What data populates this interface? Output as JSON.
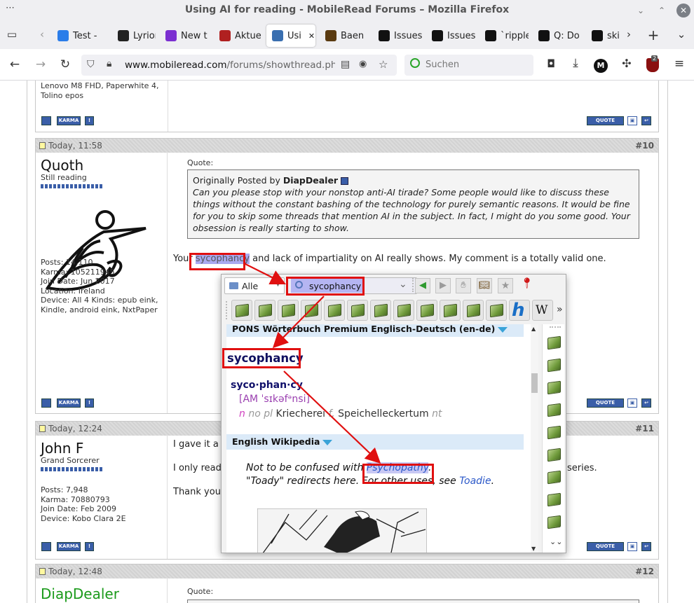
{
  "window": {
    "title": "Using AI for reading - MobileRead Forums – Mozilla Firefox",
    "menu_dots": "⋯"
  },
  "tabs": [
    {
      "label": "Test -",
      "color": "#2b7de9"
    },
    {
      "label": "Lyrion",
      "color": "#222222"
    },
    {
      "label": "New t",
      "color": "#7b2fd1"
    },
    {
      "label": "Aktue",
      "color": "#b02020"
    },
    {
      "label": "Usi",
      "color": "#3a6fb0",
      "active": true
    },
    {
      "label": "Baen",
      "color": "#5a3a10"
    },
    {
      "label": "Issues",
      "color": "#111111"
    },
    {
      "label": "Issues",
      "color": "#111111"
    },
    {
      "label": "`ripple",
      "color": "#111111"
    },
    {
      "label": "Q: Do",
      "color": "#111111"
    },
    {
      "label": "ski",
      "color": "#111111"
    }
  ],
  "nav": {
    "url": "www.mobileread.com/forums/showthread.php?p=",
    "url_domain": "www.mobileread.com",
    "url_path": "/forums/showthread.php?p=",
    "search_placeholder": "Suchen",
    "ext_badge": "2"
  },
  "posts": [
    {
      "device_tail": "Lenovo M8 FHD, Paperwhite 4, Tolino epos"
    },
    {
      "time": "Today, 11:58",
      "number": "#10",
      "username": "Quoth",
      "usertitle": "Still reading",
      "stats": [
        "Posts: 14,110",
        "Karma: 105211945",
        "Join Date: Jun 2017",
        "Location: Ireland",
        "Device: All 4 Kinds: epub eink, Kindle, android eink, NxtPaper"
      ],
      "quote_label": "Quote:",
      "quote_prefix": "Originally Posted by",
      "quote_author": "DiapDealer",
      "quote_text": "Can you please stop with your nonstop anti-AI tirade? Some people would like to discuss these things without the constant bashing of the technology for purely semantic reasons. It would be fine for you to skip some threads that mention AI in the subject. In fact, I might do you some good. Your obsession is really starting to show.",
      "reply_before": "Your",
      "reply_highlight": "sycophancy",
      "reply_after": "and lack of impartiality on AI really shows. My comment is a totally valid one."
    },
    {
      "time": "Today, 12:24",
      "number": "#11",
      "username": "John F",
      "usertitle": "Grand Sorcerer",
      "stats": [
        "Posts: 7,948",
        "Karma: 70880793",
        "Join Date: Feb 2009",
        "Device: Kobo Clara 2E"
      ],
      "lines": [
        "I gave it a tr",
        "I only read c",
        "Thank you B"
      ],
      "line_tail": "series."
    },
    {
      "time": "Today, 12:48",
      "number": "#12",
      "username": "DiapDealer",
      "quote_label": "Quote:"
    }
  ],
  "buttons": {
    "karma": "KARMA",
    "quote": "QUOTE",
    "report": "!"
  },
  "popup": {
    "dict_filter": "Alle",
    "search_value": "sycophancy",
    "dictionary1": "PONS Wörterbuch Premium Englisch-Deutsch (en-de)",
    "headword": "sycophancy",
    "syllabified": "syco·phan·cy",
    "pron_region": "AM",
    "pronunciation": "ˈsɪkəfᵊnsi",
    "pos": "n",
    "grammar": "no pl",
    "translation1": "Kriecherei",
    "separator": "f,",
    "translation2": "Speichelleckertum",
    "gender2": "nt",
    "dictionary2": "English Wikipedia",
    "wiki_line1_prefix": "Not to be confused with",
    "wiki_link1": "Psychopathy",
    "wiki_line1_suffix": ".",
    "wiki_line2_prefix": "\"Toady\" redirects here. For other uses, see",
    "wiki_link2": "Toadie",
    "wiki_line2_suffix": ".",
    "more_chevron": "»",
    "scroll_down": "⌄⌄",
    "h_icon": "h",
    "w_icon": "W"
  },
  "colors": {
    "accent_red": "#e01010",
    "highlight": "#a9a9f0",
    "link": "#2a57c8",
    "firefox_bar": "#efeff2",
    "forum_blue": "#3a5ea8",
    "diap_green": "#1a9a1a"
  }
}
